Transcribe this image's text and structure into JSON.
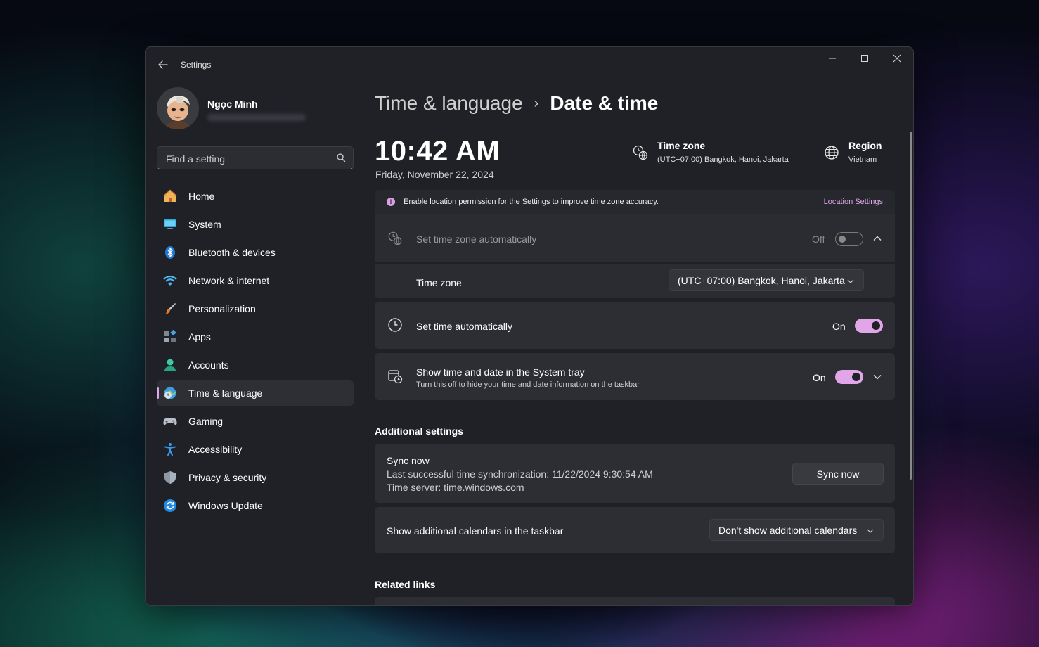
{
  "window": {
    "app_title": "Settings"
  },
  "profile": {
    "name": "Ngọc Minh"
  },
  "search": {
    "placeholder": "Find a setting"
  },
  "nav": [
    {
      "label": "Home",
      "icon": "home-icon"
    },
    {
      "label": "System",
      "icon": "system-icon"
    },
    {
      "label": "Bluetooth & devices",
      "icon": "bluetooth-icon"
    },
    {
      "label": "Network & internet",
      "icon": "network-icon"
    },
    {
      "label": "Personalization",
      "icon": "brush-icon"
    },
    {
      "label": "Apps",
      "icon": "apps-icon"
    },
    {
      "label": "Accounts",
      "icon": "accounts-icon"
    },
    {
      "label": "Time & language",
      "icon": "time-language-icon",
      "active": true
    },
    {
      "label": "Gaming",
      "icon": "gamepad-icon"
    },
    {
      "label": "Accessibility",
      "icon": "accessibility-icon"
    },
    {
      "label": "Privacy & security",
      "icon": "shield-icon"
    },
    {
      "label": "Windows Update",
      "icon": "update-icon"
    }
  ],
  "breadcrumb": {
    "parent": "Time & language",
    "separator": "›",
    "current": "Date & time"
  },
  "clock": {
    "time": "10:42 AM",
    "date": "Friday, November 22, 2024"
  },
  "timezone_info": {
    "title": "Time zone",
    "value": "(UTC+07:00) Bangkok, Hanoi, Jakarta"
  },
  "region_info": {
    "title": "Region",
    "value": "Vietnam"
  },
  "banner": {
    "text": "Enable location permission for the Settings to improve time zone accuracy.",
    "link": "Location Settings"
  },
  "auto_timezone": {
    "label": "Set time zone automatically",
    "state": "Off"
  },
  "timezone_row": {
    "label": "Time zone",
    "value": "(UTC+07:00) Bangkok, Hanoi, Jakarta"
  },
  "auto_time": {
    "label": "Set time automatically",
    "state": "On"
  },
  "tray": {
    "label": "Show time and date in the System tray",
    "description": "Turn this off to hide your time and date information on the taskbar",
    "state": "On"
  },
  "additional": {
    "title": "Additional settings",
    "sync_title": "Sync now",
    "sync_last": "Last successful time synchronization: 11/22/2024 9:30:54 AM",
    "sync_server": "Time server: time.windows.com",
    "sync_button": "Sync now",
    "calendars_label": "Show additional calendars in the taskbar",
    "calendars_value": "Don't show additional calendars"
  },
  "related": {
    "title": "Related links"
  },
  "colors": {
    "accent": "#e0a6e8",
    "window_bg": "#1f2127",
    "card_bg": "#2c2e34"
  }
}
